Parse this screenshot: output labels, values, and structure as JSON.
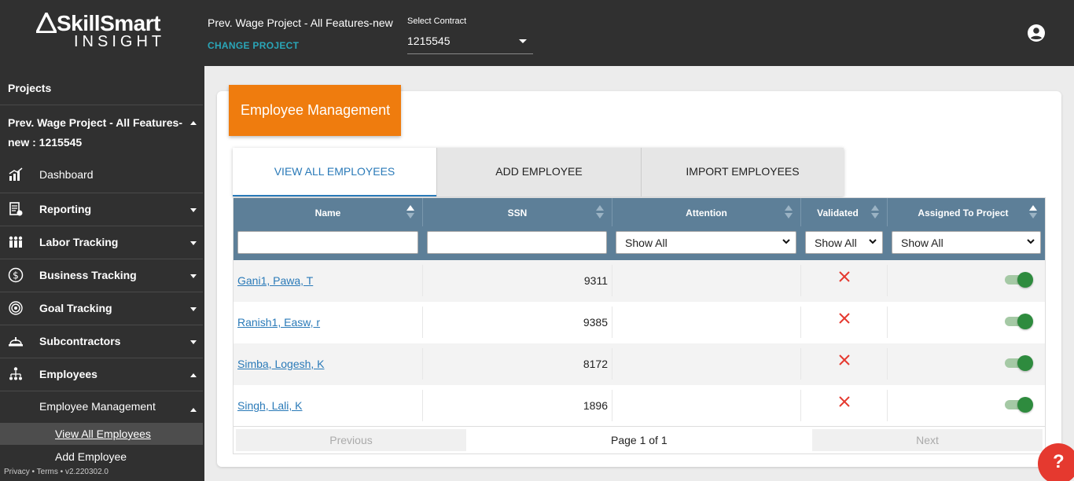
{
  "logo": {
    "brand": "SkillSmart",
    "sub": "INSIGHT"
  },
  "header": {
    "project_name": "Prev. Wage Project - All Features-new",
    "change_project": "CHANGE PROJECT",
    "contract_label": "Select Contract",
    "contract_value": "1215545"
  },
  "sidebar": {
    "projects_label": "Projects",
    "project_title": "Prev. Wage Project - All Features-new : 1215545",
    "items": [
      {
        "label": "Dashboard",
        "icon": "chart-icon"
      },
      {
        "label": "Reporting",
        "icon": "report-icon"
      },
      {
        "label": "Labor Tracking",
        "icon": "workers-icon"
      },
      {
        "label": "Business Tracking",
        "icon": "dollar-icon"
      },
      {
        "label": "Goal Tracking",
        "icon": "target-icon"
      },
      {
        "label": "Subcontractors",
        "icon": "hardhat-icon"
      },
      {
        "label": "Employees",
        "icon": "org-icon"
      }
    ],
    "sub_section": "Employee Management",
    "links": [
      "View All Employees",
      "Add Employee"
    ],
    "footer": "Privacy • Terms • v2.220302.0"
  },
  "page": {
    "title": "Employee Management",
    "tabs": [
      "VIEW ALL EMPLOYEES",
      "ADD EMPLOYEE",
      "IMPORT EMPLOYEES"
    ]
  },
  "table": {
    "columns": [
      "Name",
      "SSN",
      "Attention",
      "Validated",
      "Assigned To Project"
    ],
    "filters": {
      "attention": "Show All",
      "validated": "Show All",
      "assigned": "Show All"
    },
    "rows": [
      {
        "name": "Gani1, Pawa, T",
        "ssn": "9311",
        "validated": false,
        "assigned": true
      },
      {
        "name": "Ranish1, Easw, r",
        "ssn": "9385",
        "validated": false,
        "assigned": true
      },
      {
        "name": "Simba, Logesh, K",
        "ssn": "8172",
        "validated": false,
        "assigned": true
      },
      {
        "name": "Singh, Lali, K",
        "ssn": "1896",
        "validated": false,
        "assigned": true
      }
    ]
  },
  "pager": {
    "previous": "Previous",
    "info": "Page 1 of 1",
    "next": "Next"
  },
  "help": {
    "label": "?"
  },
  "colors": {
    "accent": "#ef7c0e",
    "header_bg": "#303030",
    "grid_head": "#5d7f98",
    "link": "#2a7ab8",
    "toggle_on": "#2e8b3e",
    "error": "#e5392f"
  }
}
